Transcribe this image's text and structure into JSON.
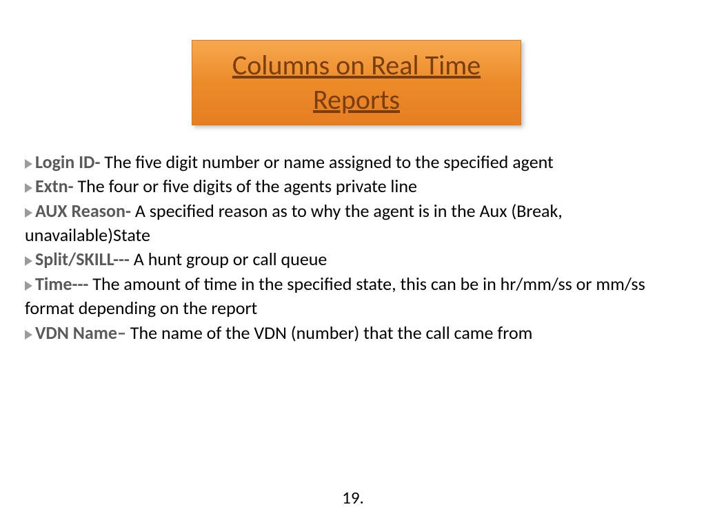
{
  "title": "Columns on Real Time Reports",
  "items": [
    {
      "term": "Login ID",
      "sep": "-",
      "desc": "  The five digit number or name assigned to the specified agent"
    },
    {
      "term": "Extn",
      "sep": "-",
      "desc": " The four or five digits of the agents private line"
    },
    {
      "term": "AUX Reason",
      "sep": "-",
      "desc": " A specified reason as to why the agent is in the Aux (Break, unavailable)State"
    },
    {
      "term": "Split/SKILL",
      "sep": "---",
      "desc": "   A hunt group or call queue"
    },
    {
      "term": "Time",
      "sep": "---",
      "desc": " The amount of time in the specified state, this can be in hr/mm/ss or mm/ss format depending on the report"
    },
    {
      "term": "VDN Name",
      "sep": "–",
      "desc": " The name of the VDN (number) that the call came from"
    }
  ],
  "page_number": "19."
}
